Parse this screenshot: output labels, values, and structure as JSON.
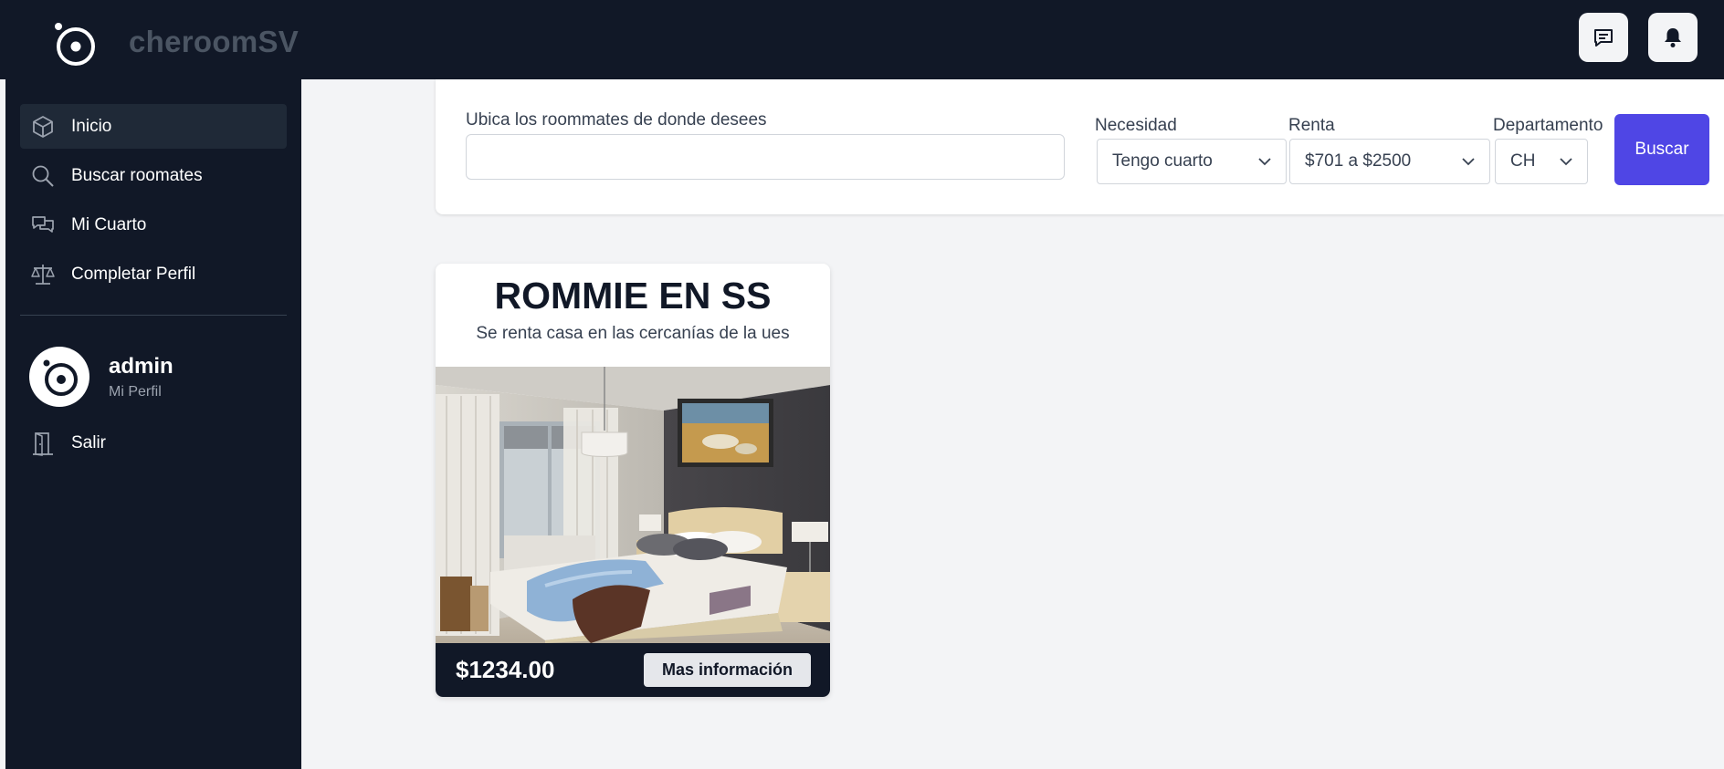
{
  "app": {
    "name": "cheroomSV",
    "logo_icon": "brand-logo-icon"
  },
  "header": {
    "actions": [
      {
        "icon": "message-icon"
      },
      {
        "icon": "bell-icon"
      }
    ]
  },
  "sidebar": {
    "items": [
      {
        "label": "Inicio",
        "icon": "cube-icon",
        "active": true
      },
      {
        "label": "Buscar roomates",
        "icon": "search-icon"
      },
      {
        "label": "Mi Cuarto",
        "icon": "chat-bubbles-icon"
      },
      {
        "label": "Completar Perfil",
        "icon": "scale-icon"
      }
    ],
    "profile": {
      "name": "admin",
      "subtitle": "Mi Perfil"
    },
    "logout": {
      "label": "Salir",
      "icon": "door-icon"
    }
  },
  "search": {
    "location_label": "Ubica los roommates de donde desees",
    "location_value": "",
    "necesidad_label": "Necesidad",
    "necesidad_value": "Tengo cuarto",
    "renta_label": "Renta",
    "renta_value": "$701 a $2500",
    "departamento_label": "Departamento",
    "departamento_value": "CH",
    "button_label": "Buscar"
  },
  "listings": [
    {
      "title": "ROMMIE EN SS",
      "description": "Se renta casa en las cercanías de la ues",
      "price": "$1234.00",
      "button_label": "Mas información"
    }
  ],
  "colors": {
    "dark": "#111827",
    "accent": "#4f46e5",
    "background": "#f3f4f6"
  }
}
